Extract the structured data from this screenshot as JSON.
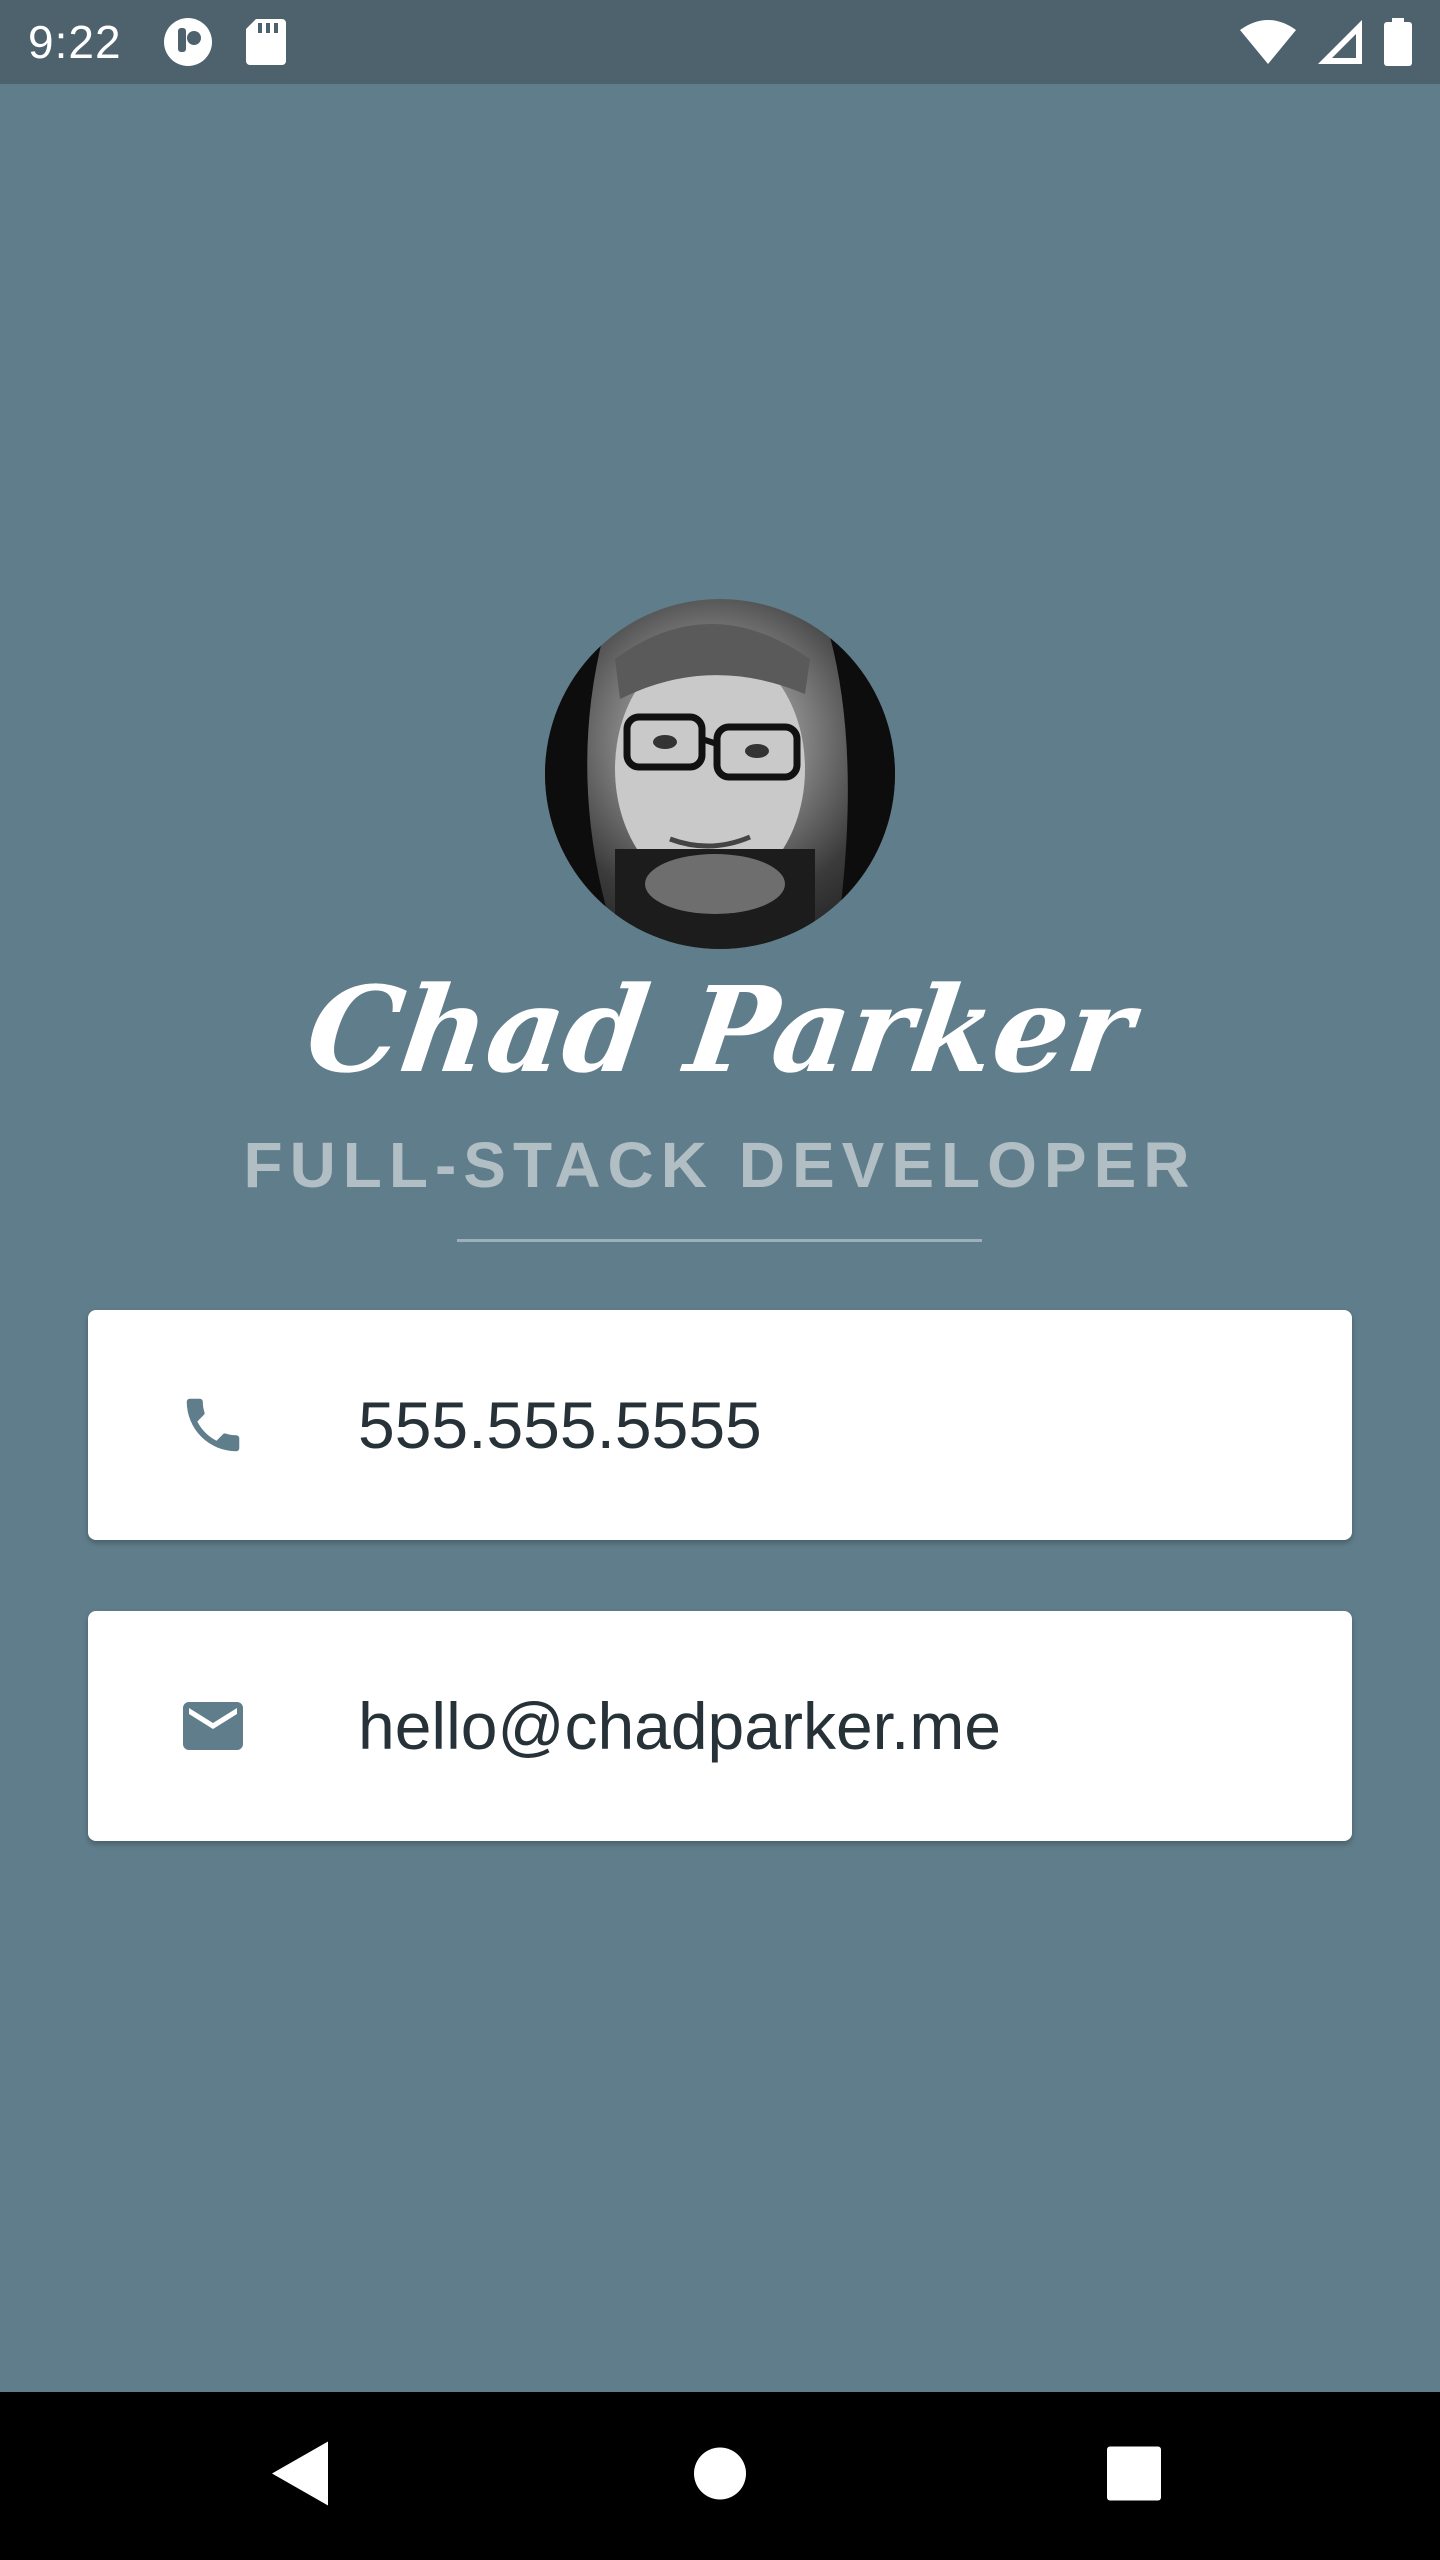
{
  "status_bar": {
    "time": "9:22",
    "left_icons": [
      "notification-app-icon",
      "sd-card-icon"
    ],
    "right_icons": [
      "wifi-icon",
      "cell-signal-icon",
      "battery-icon"
    ]
  },
  "profile": {
    "name": "Chad Parker",
    "title": "FULL-STACK DEVELOPER",
    "avatar_icon": "profile-photo"
  },
  "contacts": [
    {
      "icon": "phone-icon",
      "value": "555.555.5555"
    },
    {
      "icon": "email-icon",
      "value": "hello@chadparker.me"
    }
  ],
  "nav_bar": {
    "buttons": [
      "back-icon",
      "home-icon",
      "recents-icon"
    ]
  },
  "colors": {
    "background": "#607D8B",
    "status_bar": "#4E626D",
    "title_text": "#B1BEC4",
    "card": "#FFFFFF",
    "card_text": "#263238",
    "icon": "#607D8B"
  }
}
